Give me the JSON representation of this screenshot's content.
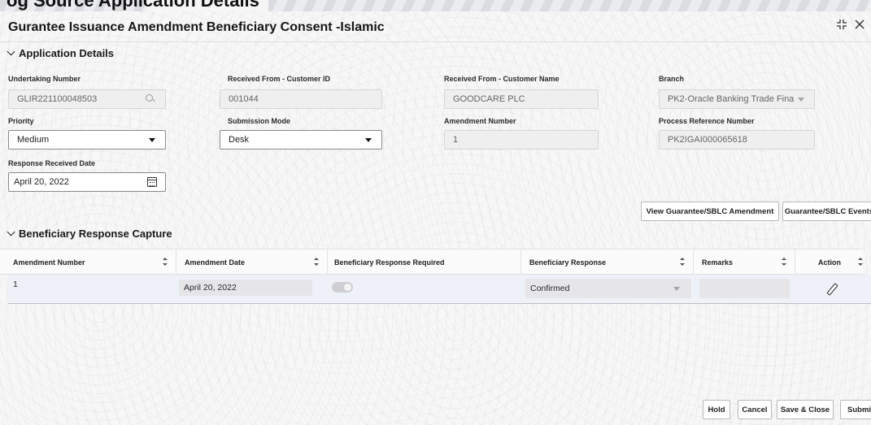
{
  "background_window": {
    "title_fragment": "og Source    Application Details"
  },
  "dialog": {
    "title": "Gurantee Issuance Amendment Beneficiary Consent -Islamic",
    "icons": [
      "resize-icon",
      "close-icon"
    ]
  },
  "application_details": {
    "section_title": "Application Details",
    "undertaking_number": {
      "label": "Undertaking Number",
      "value": "GLIR221100048503"
    },
    "customer_id": {
      "label": "Received From - Customer ID",
      "value": "001044"
    },
    "customer_name": {
      "label": "Received From - Customer Name",
      "value": "GOODCARE PLC"
    },
    "branch": {
      "label": "Branch",
      "value": "PK2-Oracle Banking Trade Fina"
    },
    "priority": {
      "label": "Priority",
      "value": "Medium"
    },
    "submission_mode": {
      "label": "Submission Mode",
      "value": "Desk"
    },
    "amendment_number": {
      "label": "Amendment Number",
      "value": "1"
    },
    "process_reference_number": {
      "label": "Process Reference Number",
      "value": "PK2IGAI000065618"
    },
    "response_received_date": {
      "label": "Response Received Date",
      "value": "April 20, 2022"
    }
  },
  "actions": {
    "view_amendment": "View Guarantee/SBLC Amendment",
    "events": "Guarantee/SBLC Events"
  },
  "beneficiary_response": {
    "section_title": "Beneficiary Response Capture",
    "columns": [
      "Amendment Number",
      "Amendment Date",
      "Beneficiary Response Required",
      "Beneficiary Response",
      "Remarks",
      "Action"
    ],
    "rows": [
      {
        "amendment_number": "1",
        "amendment_date": "April 20, 2022",
        "response_required": false,
        "beneficiary_response": "Confirmed",
        "remarks": ""
      }
    ]
  },
  "footer": {
    "hold": "Hold",
    "cancel": "Cancel",
    "save_close": "Save & Close",
    "submit": "Submit"
  },
  "colors": {
    "row_highlight": "#eef1f8",
    "readonly_field": "#efeff0"
  }
}
